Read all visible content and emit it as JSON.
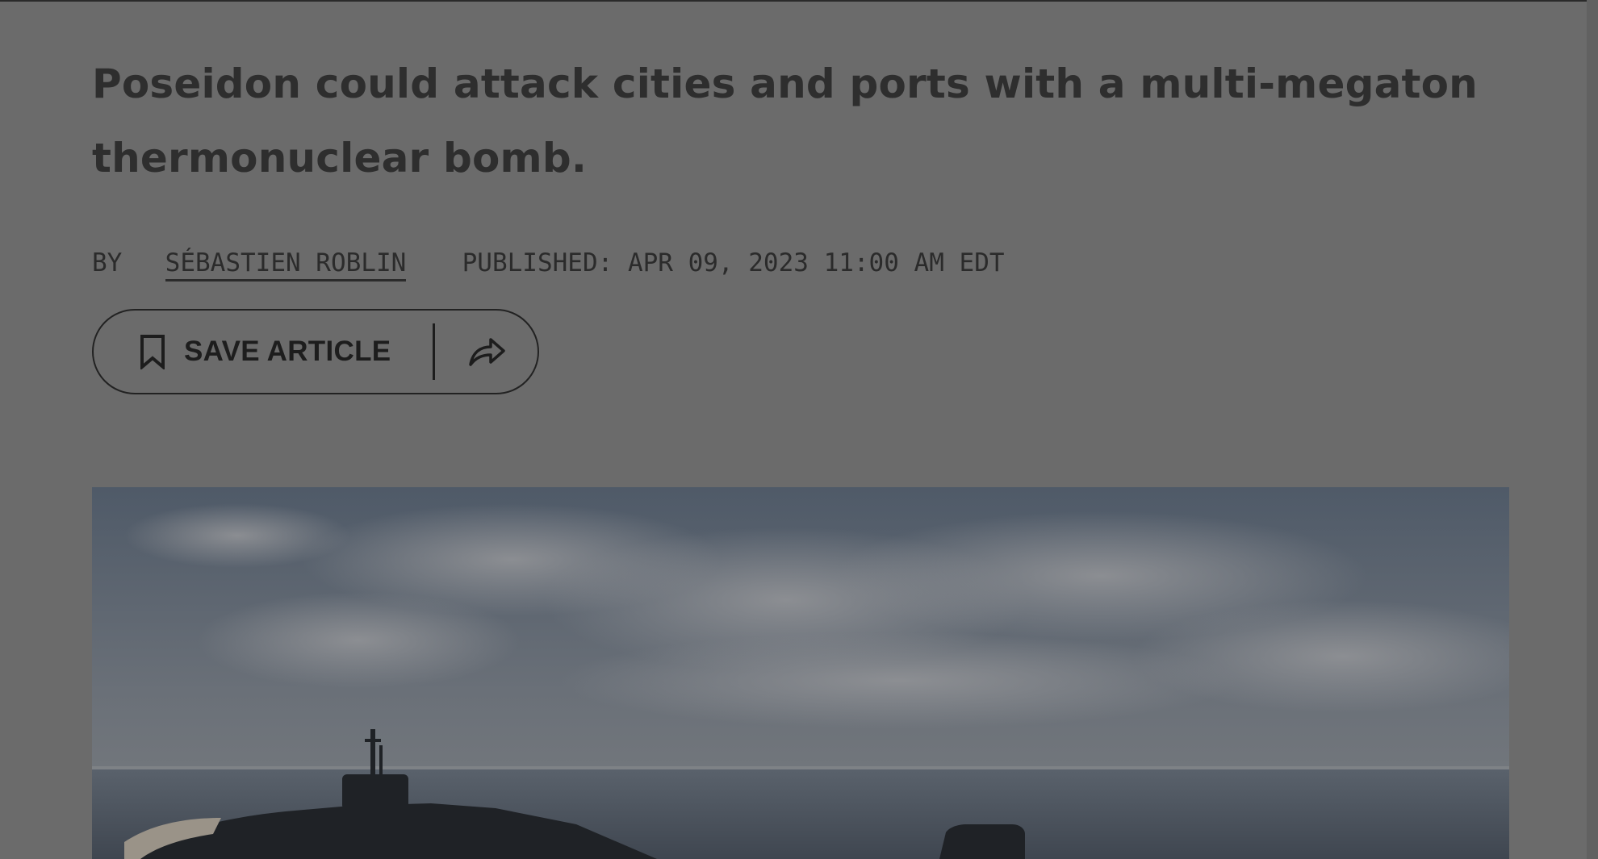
{
  "article": {
    "dek": "Poseidon could attack cities and ports with a multi-megaton thermonuclear bomb.",
    "byline": {
      "prefix": "BY",
      "author": "SÉBASTIEN ROBLIN",
      "published": "PUBLISHED: APR 09, 2023 11:00 AM EDT"
    },
    "actions": {
      "save_label": "SAVE ARTICLE",
      "save_icon": "bookmark-icon",
      "share_icon": "share-arrow-icon"
    },
    "hero_image": {
      "alt": "submarine surfacing at sea"
    }
  },
  "colors": {
    "overlay_background": "#6b6b6b",
    "text": "#2e2e2e"
  }
}
